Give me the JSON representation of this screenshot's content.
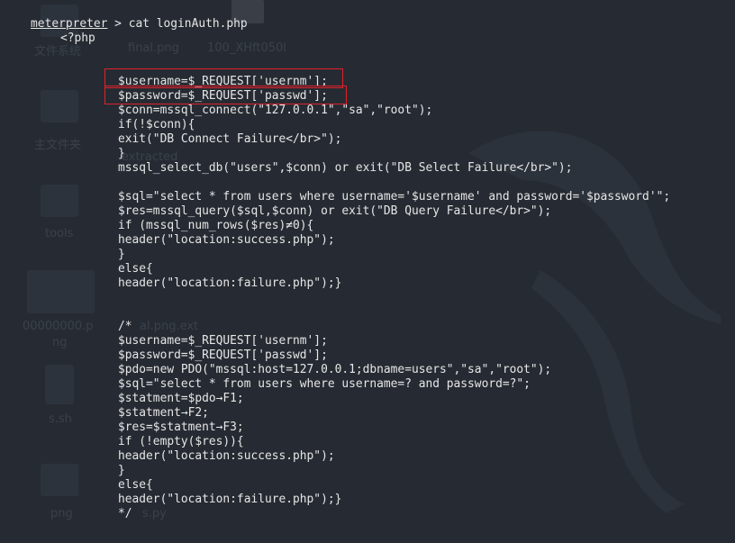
{
  "terminal": {
    "prompt_name": "meterpreter",
    "prompt_symbol": " > ",
    "command": "cat loginAuth.php",
    "output_lines": [
      "<?php",
      "$username=$_REQUEST['usernm'];",
      "$password=$_REQUEST['passwd'];",
      "$conn=mssql_connect(\"127.0.0.1\",\"sa\",\"root\");",
      "if(!$conn){",
      "exit(\"DB Connect Failure</br>\");",
      "}",
      "mssql_select_db(\"users\",$conn) or exit(\"DB Select Failure</br>\");",
      "",
      "$sql=\"select * from users where username='$username' and password='$password'\";",
      "$res=mssql_query($sql,$conn) or exit(\"DB Query Failure</br>\");",
      "if (mssql_num_rows($res)≠0){",
      "header(\"location:success.php\");",
      "}",
      "else{",
      "header(\"location:failure.php\");}",
      "",
      "",
      "/*",
      "$username=$_REQUEST['usernm'];",
      "$password=$_REQUEST['passwd'];",
      "$pdo=new PDO(\"mssql:host=127.0.0.1;dbname=users\",\"sa\",\"root\");",
      "$sql=\"select * from users where username=? and password=?\";",
      "$statment=$pdo→F1;",
      "$statment→F2;",
      "$res=$statment→F3;",
      "if (!empty($res)){",
      "header(\"location:success.php\");",
      "}",
      "else{",
      "header(\"location:failure.php\");}",
      "*/"
    ]
  },
  "desktop_background_labels": [
    "文件系统",
    "final.png",
    "100_XHft050l",
    "主文件夹",
    "extracted",
    "tools",
    "00000000.p",
    "ng",
    "al.png.ext",
    "s.sh",
    "png",
    "s.py"
  ],
  "colors": {
    "background": "#262b33",
    "text": "#e6e6e6",
    "highlight_box": "#e0202a"
  }
}
